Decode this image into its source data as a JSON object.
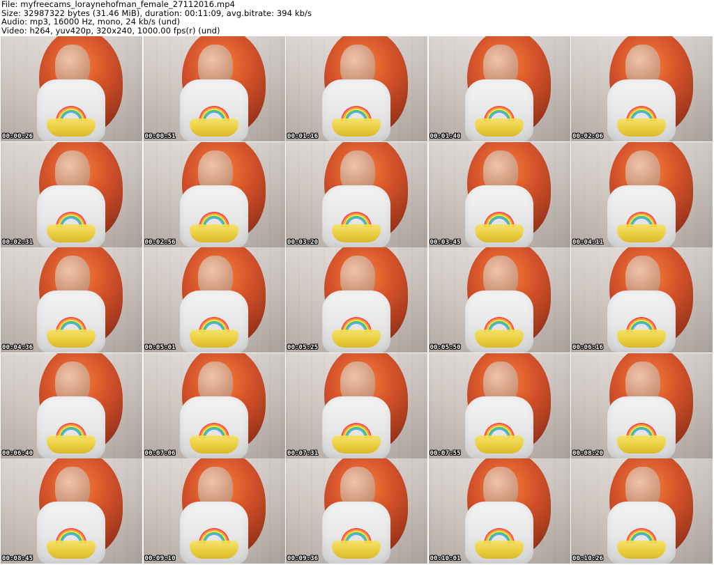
{
  "header": {
    "file_line": "File: myfreecams_loraynehofman_female_27112016.mp4",
    "size_line": "Size: 32987322 bytes (31.46 MiB), duration: 00:11:09, avg.bitrate: 394 kb/s",
    "audio_line": "Audio: mp3, 16000 Hz, mono, 24 kb/s (und)",
    "video_line": "Video: h264, yuv420p, 320x240, 1000.00 fps(r) (und)"
  },
  "thumbnails": [
    {
      "timestamp": "00:00:26"
    },
    {
      "timestamp": "00:00:51"
    },
    {
      "timestamp": "00:01:16"
    },
    {
      "timestamp": "00:01:40"
    },
    {
      "timestamp": "00:02:06"
    },
    {
      "timestamp": "00:02:31"
    },
    {
      "timestamp": "00:02:56"
    },
    {
      "timestamp": "00:03:20"
    },
    {
      "timestamp": "00:03:45"
    },
    {
      "timestamp": "00:04:11"
    },
    {
      "timestamp": "00:04:36"
    },
    {
      "timestamp": "00:05:01"
    },
    {
      "timestamp": "00:05:25"
    },
    {
      "timestamp": "00:05:50"
    },
    {
      "timestamp": "00:06:16"
    },
    {
      "timestamp": "00:06:40"
    },
    {
      "timestamp": "00:07:06"
    },
    {
      "timestamp": "00:07:31"
    },
    {
      "timestamp": "00:07:55"
    },
    {
      "timestamp": "00:08:20"
    },
    {
      "timestamp": "00:08:45"
    },
    {
      "timestamp": "00:09:10"
    },
    {
      "timestamp": "00:09:36"
    },
    {
      "timestamp": "00:10:01"
    },
    {
      "timestamp": "00:10:26"
    }
  ]
}
